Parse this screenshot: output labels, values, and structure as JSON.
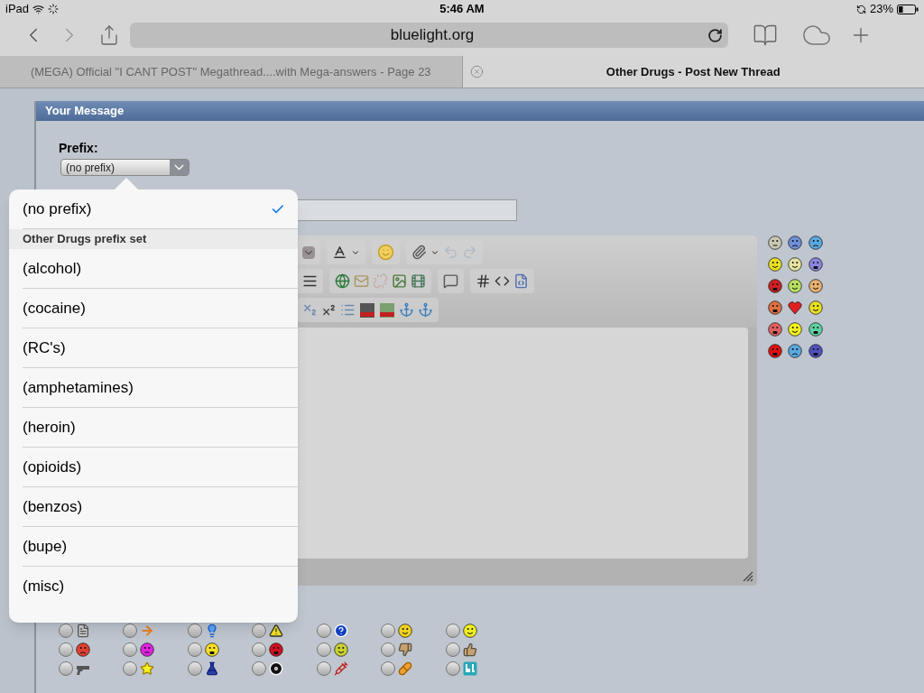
{
  "status_bar": {
    "device": "iPad",
    "time": "5:46 AM",
    "battery": "23%"
  },
  "browser": {
    "url": "bluelight.org",
    "tabs": [
      {
        "title": "(MEGA) Official \"I CANT POST\" Megathread....with Mega-answers - Page 23",
        "selected": false,
        "closable": false
      },
      {
        "title": "Other Drugs - Post New Thread",
        "selected": true,
        "closable": true
      }
    ]
  },
  "page": {
    "section_title": "Your Message",
    "prefix": {
      "label": "Prefix:",
      "value": "(no prefix)"
    }
  },
  "prefix_menu": [
    {
      "kind": "option",
      "label": "(no prefix)",
      "selected": true
    },
    {
      "kind": "header",
      "label": "Other Drugs prefix set"
    },
    {
      "kind": "option",
      "label": "(alcohol)",
      "selected": false
    },
    {
      "kind": "option",
      "label": "(cocaine)",
      "selected": false
    },
    {
      "kind": "option",
      "label": "(RC's)",
      "selected": false
    },
    {
      "kind": "option",
      "label": "(amphetamines)",
      "selected": false
    },
    {
      "kind": "option",
      "label": "(heroin)",
      "selected": false
    },
    {
      "kind": "option",
      "label": "(opioids)",
      "selected": false
    },
    {
      "kind": "option",
      "label": "(benzos)",
      "selected": false
    },
    {
      "kind": "option",
      "label": "(bupe)",
      "selected": false
    },
    {
      "kind": "option",
      "label": "(misc)",
      "selected": false
    }
  ],
  "post_icons": [
    {
      "selected": false
    },
    {
      "selected": false
    },
    {
      "selected": false
    },
    {
      "selected": false
    },
    {
      "selected": false
    },
    {
      "selected": false
    },
    {
      "selected": false
    },
    {
      "selected": false
    },
    {
      "selected": false
    },
    {
      "selected": false
    },
    {
      "selected": false
    },
    {
      "selected": false
    },
    {
      "selected": false
    },
    {
      "selected": false
    },
    {
      "selected": false
    },
    {
      "selected": false
    },
    {
      "selected": false
    },
    {
      "selected": false
    },
    {
      "selected": false
    },
    {
      "selected": false
    },
    {
      "selected": false
    }
  ]
}
